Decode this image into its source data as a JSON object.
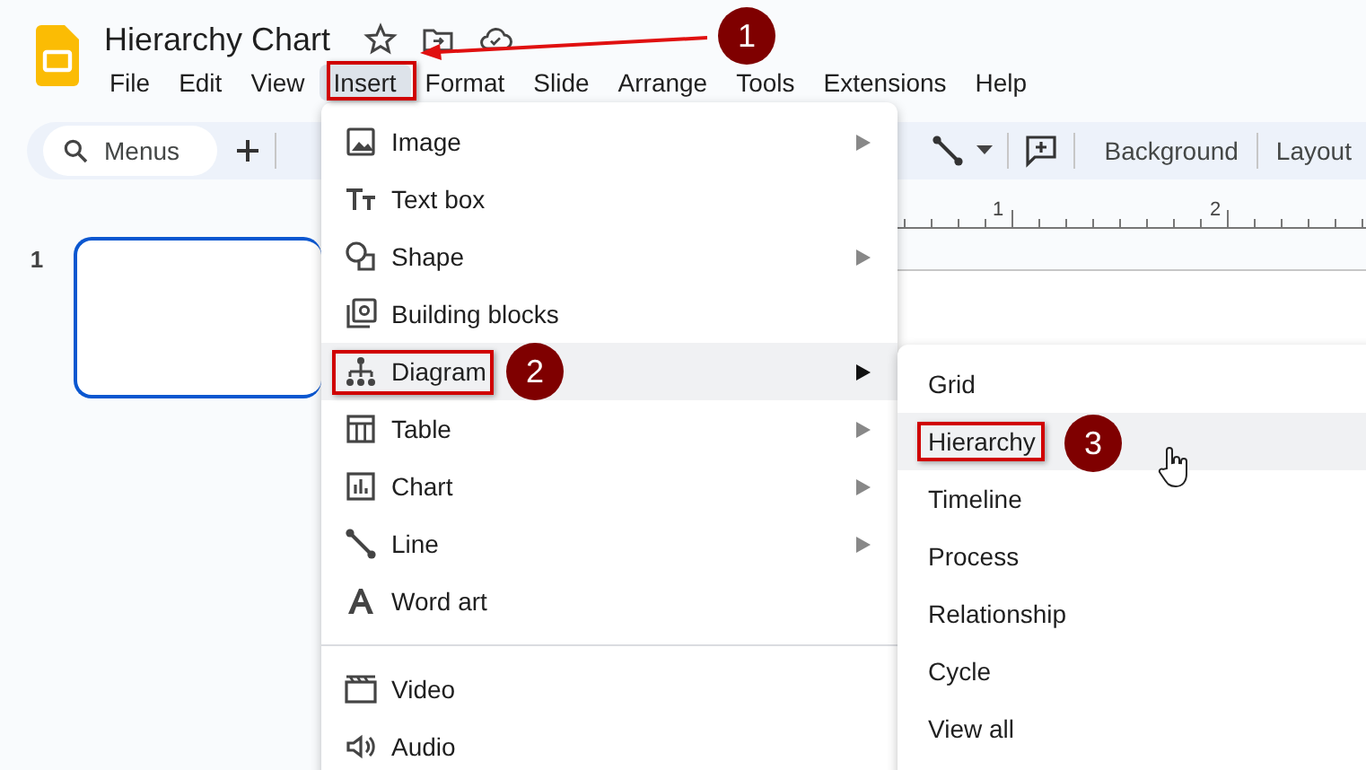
{
  "app": {
    "title": "Hierarchy Chart"
  },
  "menubar": [
    {
      "label": "File",
      "selected": false
    },
    {
      "label": "Edit",
      "selected": false
    },
    {
      "label": "View",
      "selected": false
    },
    {
      "label": "Insert",
      "selected": true
    },
    {
      "label": "Format",
      "selected": false
    },
    {
      "label": "Slide",
      "selected": false
    },
    {
      "label": "Arrange",
      "selected": false
    },
    {
      "label": "Tools",
      "selected": false
    },
    {
      "label": "Extensions",
      "selected": false
    },
    {
      "label": "Help",
      "selected": false
    }
  ],
  "toolbar": {
    "search": {
      "placeholder": "Menus"
    },
    "buttons": [
      "Background",
      "Layout"
    ]
  },
  "ruler": {
    "ticks": [
      "1",
      "2"
    ]
  },
  "filmstrip": {
    "slides": [
      {
        "number": "1",
        "selected": true
      }
    ]
  },
  "insert_menu": {
    "items": [
      {
        "kind": "item",
        "label": "Image",
        "submenu": true,
        "highlighted": false
      },
      {
        "kind": "item",
        "label": "Text box",
        "submenu": false,
        "highlighted": false
      },
      {
        "kind": "item",
        "label": "Shape",
        "submenu": true,
        "highlighted": false
      },
      {
        "kind": "item",
        "label": "Building blocks",
        "submenu": false,
        "highlighted": false
      },
      {
        "kind": "item",
        "label": "Diagram",
        "submenu": true,
        "highlighted": true
      },
      {
        "kind": "item",
        "label": "Table",
        "submenu": true,
        "highlighted": false
      },
      {
        "kind": "item",
        "label": "Chart",
        "submenu": true,
        "highlighted": false
      },
      {
        "kind": "item",
        "label": "Line",
        "submenu": true,
        "highlighted": false
      },
      {
        "kind": "item",
        "label": "Word art",
        "submenu": false,
        "highlighted": false
      },
      {
        "kind": "divider"
      },
      {
        "kind": "item",
        "label": "Video",
        "submenu": false,
        "highlighted": false
      },
      {
        "kind": "item",
        "label": "Audio",
        "submenu": false,
        "highlighted": false
      }
    ]
  },
  "diagram_submenu": {
    "items": [
      {
        "label": "Grid",
        "highlighted": false
      },
      {
        "label": "Hierarchy",
        "highlighted": true
      },
      {
        "label": "Timeline",
        "highlighted": false
      },
      {
        "label": "Process",
        "highlighted": false
      },
      {
        "label": "Relationship",
        "highlighted": false
      },
      {
        "label": "Cycle",
        "highlighted": false
      },
      {
        "label": "View all",
        "highlighted": false
      }
    ]
  },
  "annotations": [
    {
      "number": "1"
    },
    {
      "number": "2"
    },
    {
      "number": "3"
    }
  ]
}
